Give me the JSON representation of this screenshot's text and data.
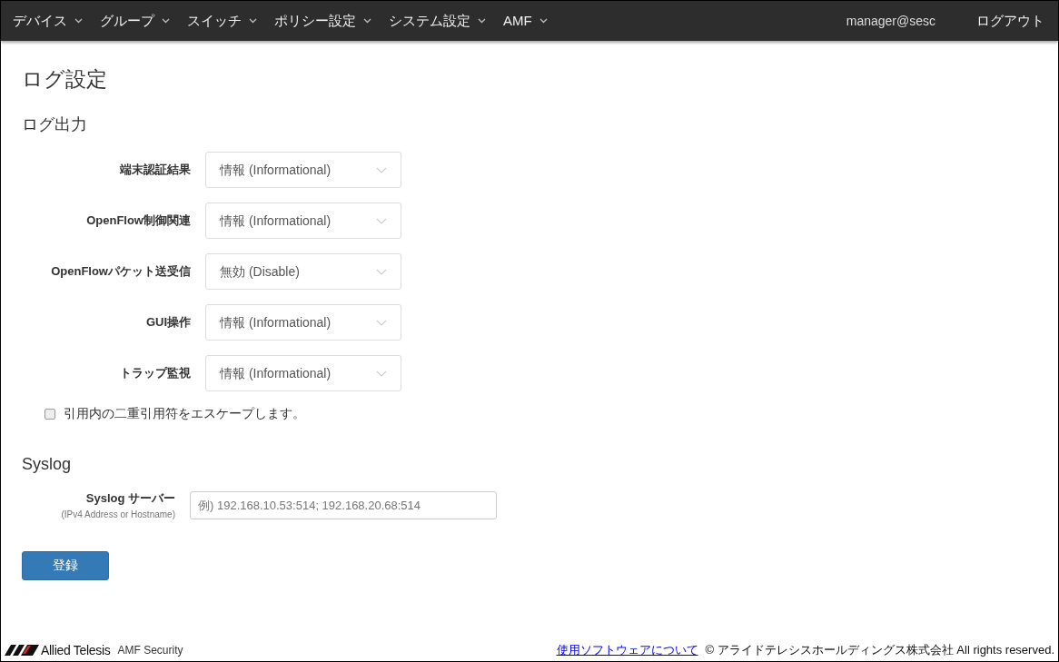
{
  "nav": {
    "menus": [
      {
        "label": "デバイス"
      },
      {
        "label": "グループ"
      },
      {
        "label": "スイッチ"
      },
      {
        "label": "ポリシー設定"
      },
      {
        "label": "システム設定"
      },
      {
        "label": "AMF"
      }
    ],
    "user": "manager@sesc",
    "logout": "ログアウト"
  },
  "page_title": "ログ設定",
  "log_output": {
    "heading": "ログ出力",
    "fields": [
      {
        "label": "端末認証結果",
        "value": "情報 (Informational)"
      },
      {
        "label": "OpenFlow制御関連",
        "value": "情報 (Informational)"
      },
      {
        "label": "OpenFlowパケット送受信",
        "value": "無効 (Disable)"
      },
      {
        "label": "GUI操作",
        "value": "情報 (Informational)"
      },
      {
        "label": "トラップ監視",
        "value": "情報 (Informational)"
      }
    ],
    "escape_checkbox": {
      "label": "引用内の二重引用符をエスケープします。",
      "checked": false
    }
  },
  "syslog": {
    "heading": "Syslog",
    "label": "Syslog サーバー",
    "hint": "(IPv4 Address or Hostname)",
    "placeholder": "例) 192.168.10.53:514; 192.168.20.68:514"
  },
  "submit": "登録",
  "footer": {
    "brand": "Allied Telesis",
    "product": "AMF Security",
    "link": "使用ソフトウェアについて",
    "copyright": "© アライドテレシスホールディングス株式会社 All rights reserved."
  }
}
